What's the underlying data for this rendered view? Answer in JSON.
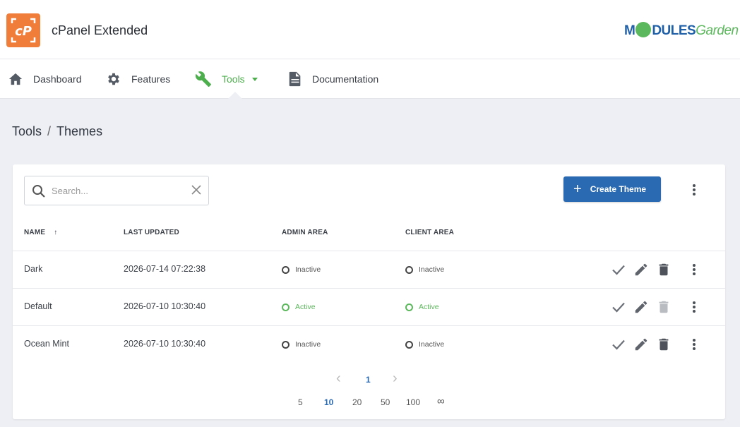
{
  "app": {
    "title": "cPanel Extended",
    "logo_text": "cP"
  },
  "brand": {
    "part1": "M",
    "part2": "DULES",
    "part3": "Garden"
  },
  "nav": {
    "items": [
      {
        "label": "Dashboard",
        "icon": "home-icon"
      },
      {
        "label": "Features",
        "icon": "gear-icon"
      },
      {
        "label": "Tools",
        "icon": "wrench-icon",
        "active": true
      },
      {
        "label": "Documentation",
        "icon": "document-icon"
      }
    ]
  },
  "breadcrumb": {
    "parent": "Tools",
    "separator": "/",
    "current": "Themes"
  },
  "toolbar": {
    "search_placeholder": "Search...",
    "create_label": "Create Theme"
  },
  "table": {
    "columns": [
      "NAME",
      "LAST UPDATED",
      "ADMIN AREA",
      "CLIENT AREA"
    ],
    "sort_indicator": "↑",
    "rows": [
      {
        "name": "Dark",
        "updated": "2026-07-14 07:22:38",
        "admin": "Inactive",
        "client": "Inactive"
      },
      {
        "name": "Default",
        "updated": "2026-07-10 10:30:40",
        "admin": "Active",
        "client": "Active"
      },
      {
        "name": "Ocean Mint",
        "updated": "2026-07-10 10:30:40",
        "admin": "Inactive",
        "client": "Inactive"
      }
    ]
  },
  "pagination": {
    "prev": "‹",
    "next": "›",
    "current_page": "1",
    "per_page_options": [
      "5",
      "10",
      "20",
      "50",
      "100",
      "∞"
    ],
    "selected_per_page": "10"
  },
  "colors": {
    "accent_green": "#5cb85c",
    "primary_blue": "#2a6ab3",
    "logo_orange": "#f07e3a"
  }
}
